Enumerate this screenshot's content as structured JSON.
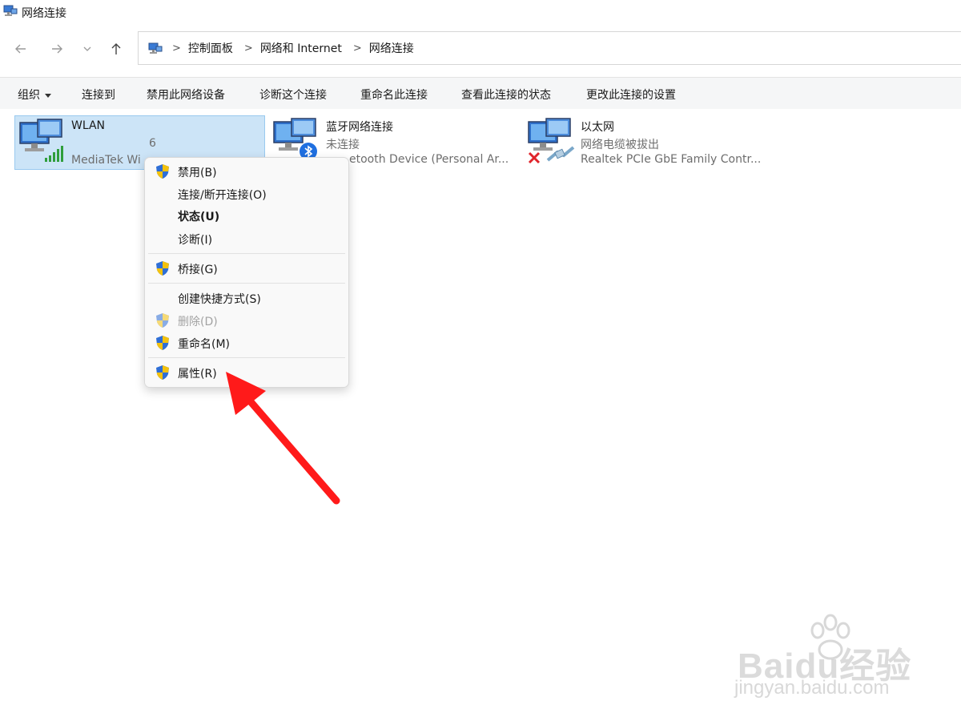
{
  "window": {
    "title": "网络连接",
    "icon": "network-connections-icon"
  },
  "nav": {
    "back_icon": "arrow-left-icon",
    "forward_icon": "arrow-right-icon",
    "recent_icon": "chevron-down-icon",
    "up_icon": "arrow-up-icon",
    "breadcrumbs": [
      "控制面板",
      "网络和 Internet",
      "网络连接"
    ]
  },
  "toolbar": {
    "organize": "组织",
    "connect_to": "连接到",
    "disable_device": "禁用此网络设备",
    "diagnose": "诊断这个连接",
    "rename": "重命名此连接",
    "view_status": "查看此连接的状态",
    "change_settings": "更改此连接的设置"
  },
  "connections": [
    {
      "name": "WLAN",
      "status": "6",
      "device": "MediaTek Wi",
      "selected": true,
      "badge": "wifi-signal-icon"
    },
    {
      "name": "蓝牙网络连接",
      "status": "未连接",
      "device": "etooth Device (Personal Ar...",
      "selected": false,
      "badge": "bluetooth-icon"
    },
    {
      "name": "以太网",
      "status": "网络电缆被拔出",
      "device": "Realtek PCIe GbE Family Contr...",
      "selected": false,
      "badge": "disconnected-x-icon"
    }
  ],
  "context_menu": {
    "items": [
      {
        "label": "禁用(B)",
        "shield": true
      },
      {
        "label": "连接/断开连接(O)",
        "shield": false
      },
      {
        "label": "状态(U)",
        "shield": false,
        "bold": true
      },
      {
        "label": "诊断(I)",
        "shield": false
      },
      {
        "label": "桥接(G)",
        "shield": true
      },
      {
        "label": "创建快捷方式(S)",
        "shield": false
      },
      {
        "label": "删除(D)",
        "shield": true,
        "disabled": true
      },
      {
        "label": "重命名(M)",
        "shield": true
      },
      {
        "label": "属性(R)",
        "shield": true
      }
    ]
  },
  "annotation": {
    "color": "#ff1a1a",
    "points_to": "属性(R)"
  },
  "watermark": {
    "brand": "Baidu经验",
    "url": "jingyan.baidu.com"
  },
  "colors": {
    "selection_bg": "#cce4f7",
    "selection_border": "#99c9ef",
    "toolbar_bg": "#f5f6f7",
    "shield_blue": "#2f6fd6",
    "shield_yellow": "#f4c20d"
  }
}
